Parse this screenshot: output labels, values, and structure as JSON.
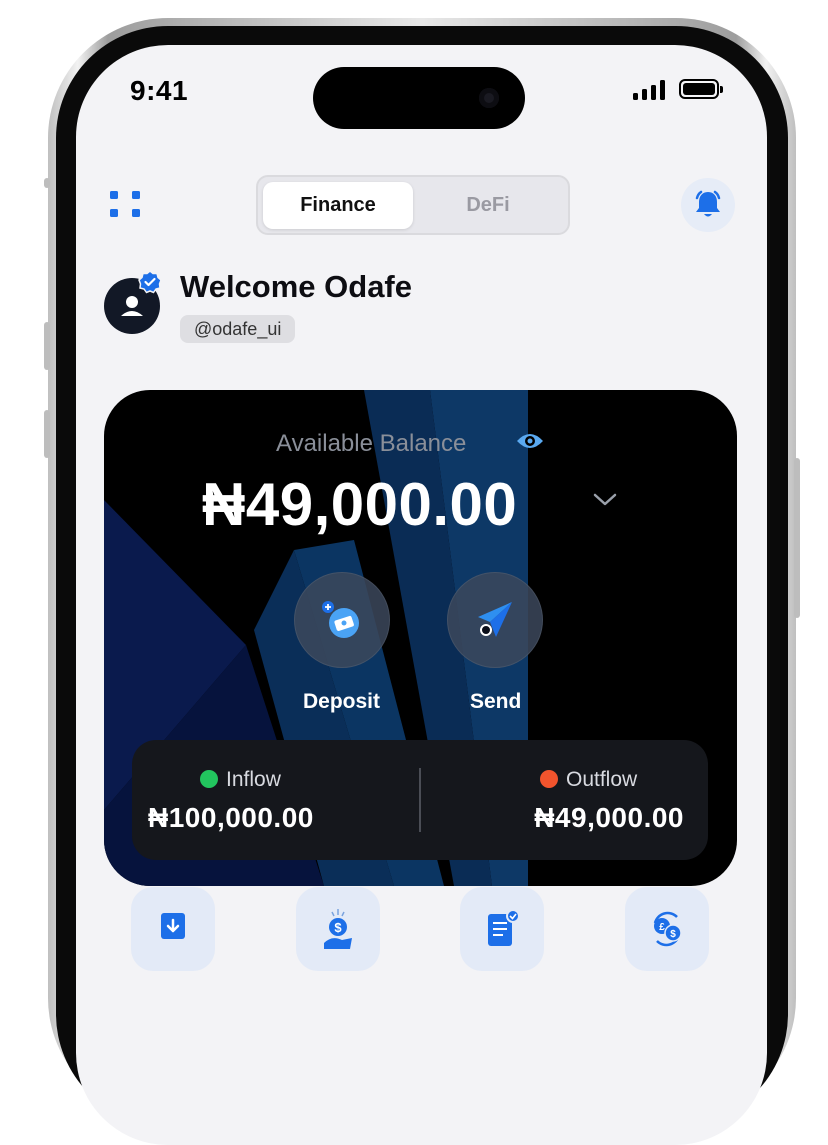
{
  "status_bar": {
    "time": "9:41"
  },
  "header": {
    "tabs": [
      {
        "label": "Finance",
        "active": true
      },
      {
        "label": "DeFi",
        "active": false
      }
    ]
  },
  "profile": {
    "welcome": "Welcome Odafe",
    "handle": "@odafe_ui"
  },
  "balance_card": {
    "label": "Available Balance",
    "amount": "₦49,000.00",
    "actions": [
      {
        "label": "Deposit",
        "icon": "deposit-icon"
      },
      {
        "label": "Send",
        "icon": "send-icon"
      }
    ],
    "inflow": {
      "label": "Inflow",
      "amount": "₦100,000.00",
      "color": "#22c55e"
    },
    "outflow": {
      "label": "Outflow",
      "amount": "₦49,000.00",
      "color": "#f2542d"
    }
  },
  "quick_actions": [
    {
      "icon": "withdraw-icon"
    },
    {
      "icon": "savings-icon"
    },
    {
      "icon": "bills-icon"
    },
    {
      "icon": "currency-exchange-icon"
    }
  ],
  "colors": {
    "accent": "#1d6fe8",
    "card_bg": "#000000",
    "screen_bg": "#f3f3f6"
  }
}
